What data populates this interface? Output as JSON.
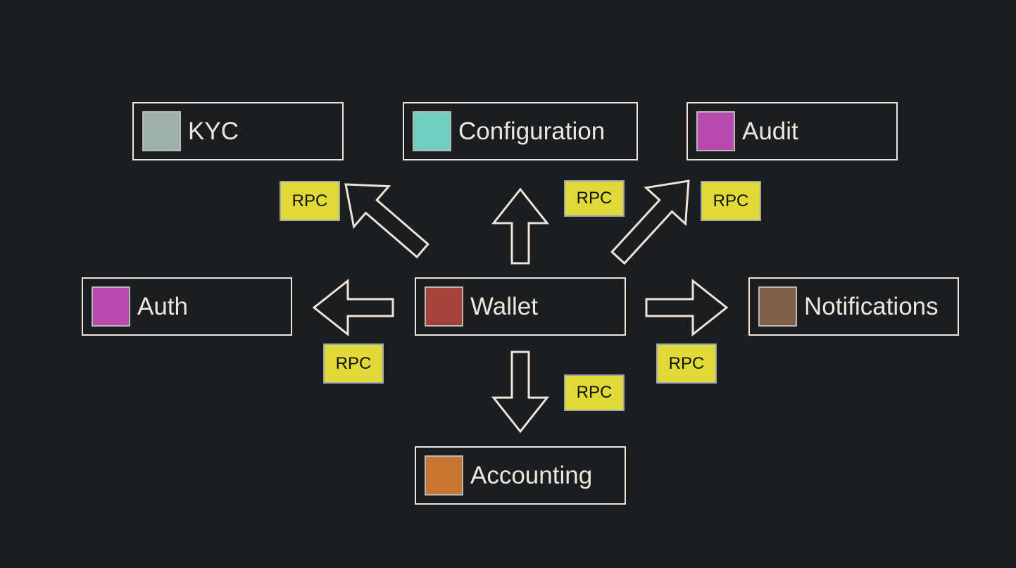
{
  "services": [
    {
      "id": "kyc",
      "label": "KYC",
      "color": "#9fb0aa"
    },
    {
      "id": "configuration",
      "label": "Configuration",
      "color": "#6fcfbf"
    },
    {
      "id": "audit",
      "label": "Audit",
      "color": "#b84aad"
    },
    {
      "id": "auth",
      "label": "Auth",
      "color": "#b84aad"
    },
    {
      "id": "wallet",
      "label": "Wallet",
      "color": "#a5423a"
    },
    {
      "id": "notifications",
      "label": "Notifications",
      "color": "#7f5f45"
    },
    {
      "id": "accounting",
      "label": "Accounting",
      "color": "#c8762f"
    }
  ],
  "rpc_label": "RPC",
  "edges": [
    {
      "from": "wallet",
      "to": "kyc",
      "label": "RPC"
    },
    {
      "from": "wallet",
      "to": "configuration",
      "label": "RPC"
    },
    {
      "from": "wallet",
      "to": "audit",
      "label": "RPC"
    },
    {
      "from": "wallet",
      "to": "auth",
      "label": "RPC"
    },
    {
      "from": "wallet",
      "to": "notifications",
      "label": "RPC"
    },
    {
      "from": "wallet",
      "to": "accounting",
      "label": "RPC"
    }
  ]
}
